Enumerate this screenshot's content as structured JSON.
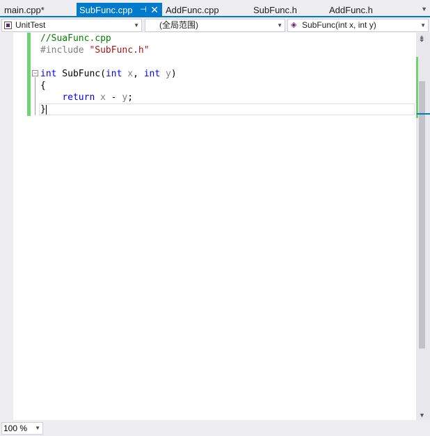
{
  "tabs": [
    {
      "label": "main.cpp*",
      "active": false
    },
    {
      "label": "SubFunc.cpp",
      "active": true
    },
    {
      "label": "AddFunc.cpp",
      "active": false
    },
    {
      "label": "SubFunc.h",
      "active": false
    },
    {
      "label": "AddFunc.h",
      "active": false
    }
  ],
  "active_tab_icons": {
    "pin": "pin-icon",
    "close": "close-icon"
  },
  "navbar": {
    "project": "UnitTest",
    "scope": "(全局范围)",
    "member": "SubFunc(int x, int y)"
  },
  "code": {
    "line1": "//SuaFunc.cpp",
    "line2_directive": "#include ",
    "line2_string": "\"SubFunc.h\"",
    "line4_kw1": "int",
    "line4_name": " SubFunc(",
    "line4_kw2": "int",
    "line4_p1": " x",
    "line4_comma": ", ",
    "line4_kw3": "int",
    "line4_p2": " y",
    "line4_close": ")",
    "line5": "{",
    "line6_indent": "    ",
    "line6_kw": "return",
    "line6_x": " x",
    "line6_op": " - ",
    "line6_y": "y",
    "line6_semi": ";",
    "line7": "}"
  },
  "zoom": "100 %",
  "colors": {
    "accent": "#007acc",
    "keyword": "#0000ff",
    "comment": "#008000",
    "string": "#a31515",
    "change_bar": "#6fd36f"
  }
}
